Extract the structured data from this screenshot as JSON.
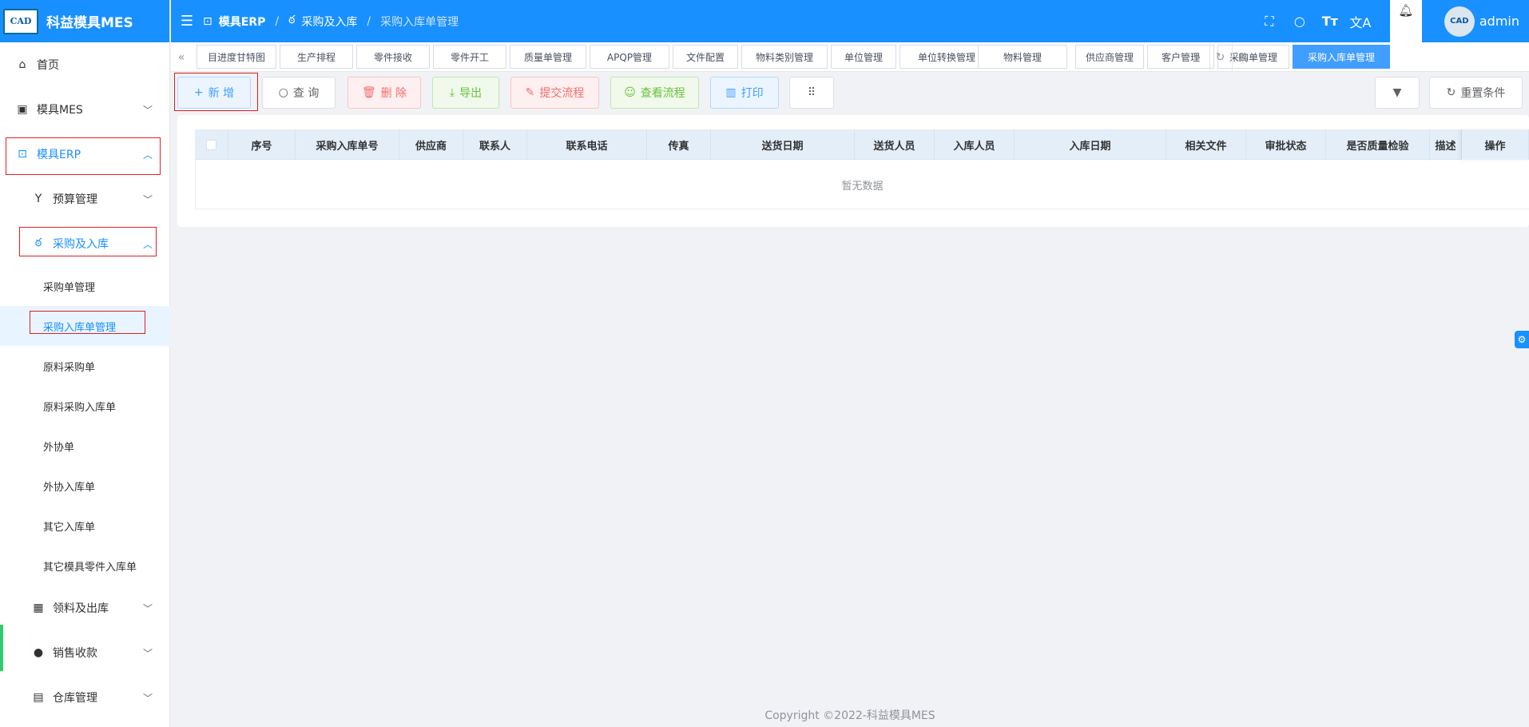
{
  "app": {
    "title": "科益模具MES",
    "logo_text": "CAD"
  },
  "sidebar": {
    "home": "首页",
    "mes": "模具MES",
    "erp": "模具ERP",
    "budget": "预算管理",
    "purchase": "采购及入库",
    "purchase_items": [
      "采购单管理",
      "采购入库单管理",
      "原料采购单",
      "原料采购入库单",
      "外协单",
      "外协入库单",
      "其它入库单",
      "其它模具零件入库单"
    ],
    "material_out": "领料及出库",
    "sales": "销售收款",
    "warehouse": "仓库管理"
  },
  "header": {
    "breadcrumb": [
      "模具ERP",
      "采购及入库",
      "采购入库单管理"
    ],
    "user": "admin"
  },
  "tabs": [
    "目进度甘特图",
    "生产排程",
    "零件接收",
    "零件开工",
    "质量单管理",
    "APQP管理",
    "文件配置",
    "物料类别管理",
    "单位管理",
    "单位转换管理",
    "物料管理",
    "供应商管理",
    "客户管理",
    "采购单管理",
    "采购入库单管理"
  ],
  "toolbar": {
    "add": "新 增",
    "query": "查 询",
    "delete": "删 除",
    "export": "导出",
    "submit_flow": "提交流程",
    "view_flow": "查看流程",
    "print": "打印",
    "reset": "重置条件"
  },
  "table": {
    "columns": [
      "序号",
      "采购入库单号",
      "供应商",
      "联系人",
      "联系电话",
      "传真",
      "送货日期",
      "送货人员",
      "入库人员",
      "入库日期",
      "相关文件",
      "审批状态",
      "是否质量检验",
      "描述",
      "操作"
    ],
    "empty_text": "暂无数据"
  },
  "footer": "Copyright ©2022-科益模具MES",
  "colors": {
    "primary": "#1890ff",
    "highlight": "#e02020"
  }
}
